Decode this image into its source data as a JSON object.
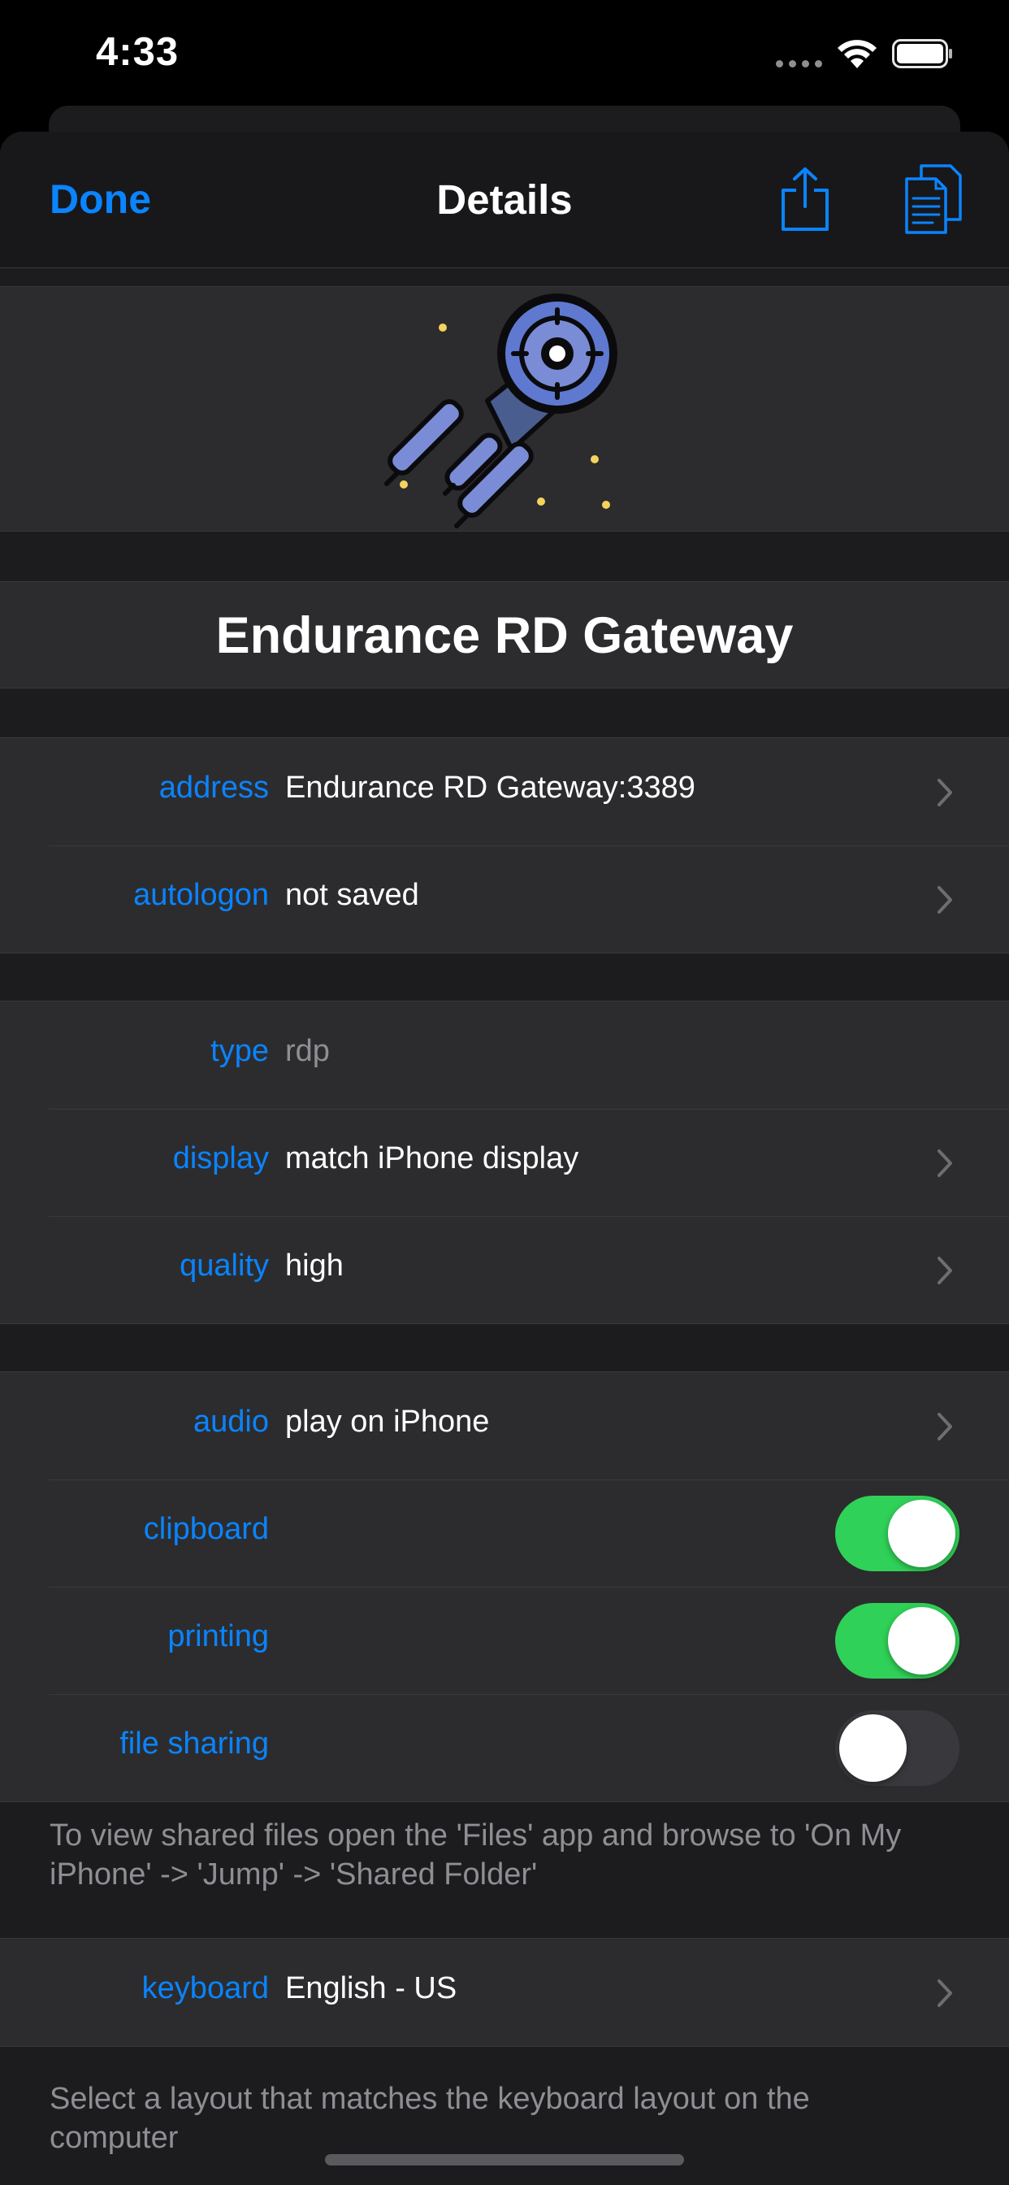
{
  "status_bar": {
    "time": "4:33"
  },
  "navbar": {
    "done_label": "Done",
    "title": "Details"
  },
  "connection": {
    "name": "Endurance RD Gateway"
  },
  "groups": {
    "connection": [
      {
        "label": "address",
        "value": "Endurance RD Gateway:3389"
      },
      {
        "label": "autologon",
        "value": "not saved"
      }
    ],
    "settings": [
      {
        "label": "type",
        "value": "rdp"
      },
      {
        "label": "display",
        "value": "match iPhone display"
      },
      {
        "label": "quality",
        "value": "high"
      }
    ],
    "sharing": [
      {
        "label": "audio",
        "value": "play on iPhone"
      },
      {
        "label": "clipboard",
        "enabled": true
      },
      {
        "label": "printing",
        "enabled": true
      },
      {
        "label": "file sharing",
        "enabled": false
      }
    ],
    "keyboard": [
      {
        "label": "keyboard",
        "value": "English - US"
      }
    ]
  },
  "footnotes": {
    "file_sharing": "To view shared files open the 'Files' app and browse to 'On My iPhone' -> 'Jump' -> 'Shared Folder'",
    "keyboard": "Select a layout that matches the keyboard layout on the computer"
  },
  "colors": {
    "accent": "#0a84ff",
    "toggle_on": "#30d158",
    "toggle_off": "#39393d",
    "cell_background": "#2c2c2e",
    "grouped_background": "#1c1c1e"
  },
  "icons": [
    "share-icon",
    "documents-icon",
    "spaceship-icon",
    "chevron-right-icon",
    "wifi-icon",
    "battery-icon"
  ]
}
